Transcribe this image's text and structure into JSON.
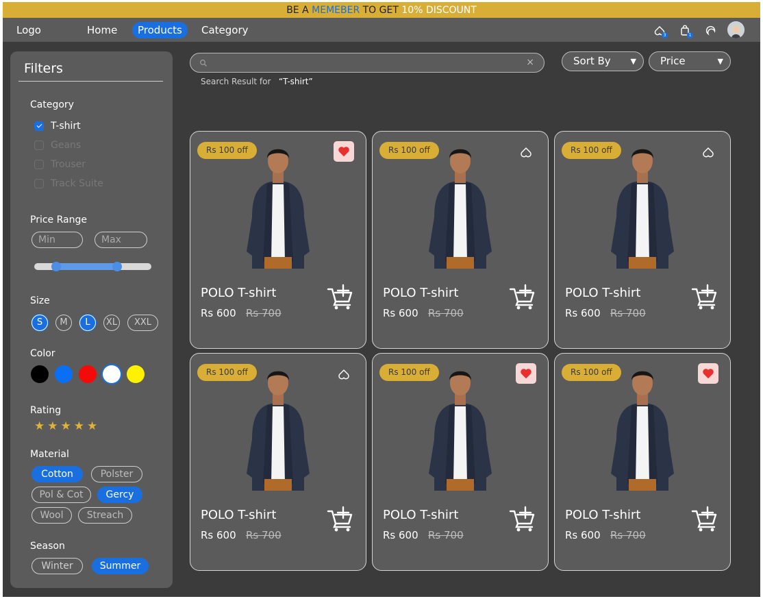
{
  "promo": {
    "prefix": "BE A ",
    "highlight": "MEMEBER",
    "middle": " TO GET ",
    "accent": "10% DISCOUNT",
    "suffix": "",
    "background": "#d9ae36"
  },
  "nav": {
    "logo": "Logo",
    "links": [
      {
        "label": "Home",
        "active": false
      },
      {
        "label": "Products",
        "active": true
      },
      {
        "label": "Category",
        "active": false
      }
    ],
    "icons": [
      {
        "name": "wishlist-icon",
        "badge": "3"
      },
      {
        "name": "shopping-bag-icon",
        "badge": "1"
      },
      {
        "name": "dark-mode-icon",
        "badge": ""
      }
    ],
    "accent": "#1a6fe0"
  },
  "filters": {
    "title": "Filters",
    "category": {
      "label": "Category",
      "items": [
        {
          "label": "T-shirt",
          "checked": true
        },
        {
          "label": "Geans",
          "checked": false
        },
        {
          "label": "Trouser",
          "checked": false
        },
        {
          "label": "Track Suite",
          "checked": false
        }
      ]
    },
    "price_range": {
      "label": "Price Range",
      "min_placeholder": "Min",
      "max_placeholder": "Max",
      "slider_low": 0.19,
      "slider_high": 0.71
    },
    "size": {
      "label": "Size",
      "options": [
        {
          "label": "S",
          "selected": true
        },
        {
          "label": "M",
          "selected": false
        },
        {
          "label": "L",
          "selected": true
        },
        {
          "label": "XL",
          "selected": false
        },
        {
          "label": "XXL",
          "selected": false
        }
      ]
    },
    "color": {
      "label": "Color",
      "swatches": [
        {
          "name": "black",
          "hex": "#000000",
          "selected": false
        },
        {
          "name": "blue",
          "hex": "#0b6ff5",
          "selected": false
        },
        {
          "name": "red",
          "hex": "#f50a0a",
          "selected": false
        },
        {
          "name": "white",
          "hex": "#ffffff",
          "selected": true
        },
        {
          "name": "yellow",
          "hex": "#fff200",
          "selected": false
        }
      ]
    },
    "rating": {
      "label": "Rating",
      "stars": "★★★★★",
      "value": 5,
      "star_color": "#e0b23a"
    },
    "material": {
      "label": "Material",
      "options": [
        {
          "label": "Cotton",
          "selected": true
        },
        {
          "label": "Polster",
          "selected": false
        },
        {
          "label": "Pol & Cot",
          "selected": false
        },
        {
          "label": "Gercy",
          "selected": true
        },
        {
          "label": "Wool",
          "selected": false
        },
        {
          "label": "Streach",
          "selected": false
        }
      ]
    },
    "season": {
      "label": "Season",
      "options": [
        {
          "label": "Winter",
          "selected": false
        },
        {
          "label": "Summer",
          "selected": true
        }
      ]
    }
  },
  "search": {
    "value": "",
    "clear_label": "×",
    "result_prefix": "Search Result for",
    "result_query": "“T-shirt”"
  },
  "sort": {
    "sort_label": "Sort By",
    "price_label": "Price",
    "caret": "▼"
  },
  "products": [
    {
      "discount": "Rs 100 off",
      "name": "POLO T-shirt",
      "price": "Rs 600",
      "old_price": "Rs 700",
      "favorite": true
    },
    {
      "discount": "Rs 100 off",
      "name": "POLO T-shirt",
      "price": "Rs 600",
      "old_price": "Rs 700",
      "favorite": false
    },
    {
      "discount": "Rs 100 off",
      "name": "POLO T-shirt",
      "price": "Rs 600",
      "old_price": "Rs 700",
      "favorite": false
    },
    {
      "discount": "Rs 100 off",
      "name": "POLO T-shirt",
      "price": "Rs 600",
      "old_price": "Rs 700",
      "favorite": false
    },
    {
      "discount": "Rs 100 off",
      "name": "POLO T-shirt",
      "price": "Rs 600",
      "old_price": "Rs 700",
      "favorite": true
    },
    {
      "discount": "Rs 100 off",
      "name": "POLO T-shirt",
      "price": "Rs 600",
      "old_price": "Rs 700",
      "favorite": true
    }
  ]
}
